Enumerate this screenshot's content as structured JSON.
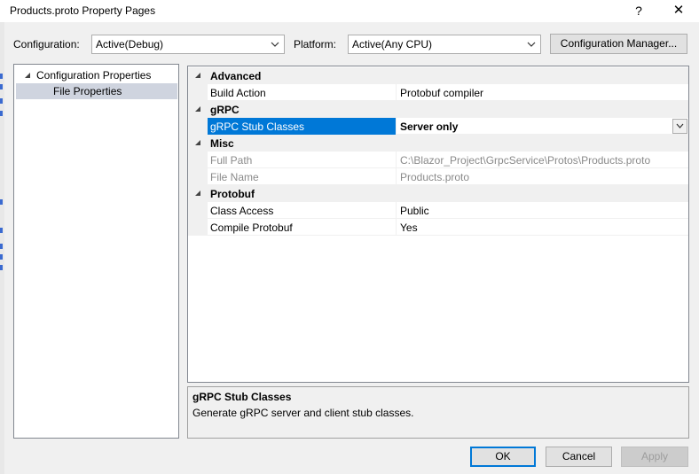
{
  "window": {
    "title": "Products.proto Property Pages",
    "help_glyph": "?",
    "close_glyph": "✕"
  },
  "toolbar": {
    "configuration_label": "Configuration:",
    "configuration_value": "Active(Debug)",
    "platform_label": "Platform:",
    "platform_value": "Active(Any CPU)",
    "config_manager_label": "Configuration Manager..."
  },
  "tree": {
    "root_label": "Configuration Properties",
    "child_label": "File Properties"
  },
  "grid": {
    "categories": {
      "advanced": "Advanced",
      "grpc": "gRPC",
      "misc": "Misc",
      "protobuf": "Protobuf"
    },
    "rows": {
      "build_action": {
        "name": "Build Action",
        "value": "Protobuf compiler"
      },
      "grpc_stub_classes": {
        "name": "gRPC Stub Classes",
        "value": "Server only"
      },
      "full_path": {
        "name": "Full Path",
        "value": "C:\\Blazor_Project\\GrpcService\\Protos\\Products.proto"
      },
      "file_name": {
        "name": "File Name",
        "value": "Products.proto"
      },
      "class_access": {
        "name": "Class Access",
        "value": "Public"
      },
      "compile_protobuf": {
        "name": "Compile Protobuf",
        "value": "Yes"
      }
    }
  },
  "description": {
    "title": "gRPC Stub Classes",
    "text": "Generate gRPC server and client stub classes."
  },
  "buttons": {
    "ok": "OK",
    "cancel": "Cancel",
    "apply": "Apply"
  },
  "colors": {
    "selection": "#0078d7",
    "tree_selection": "#cfd4df",
    "dialog_bg": "#f0f0f0"
  }
}
